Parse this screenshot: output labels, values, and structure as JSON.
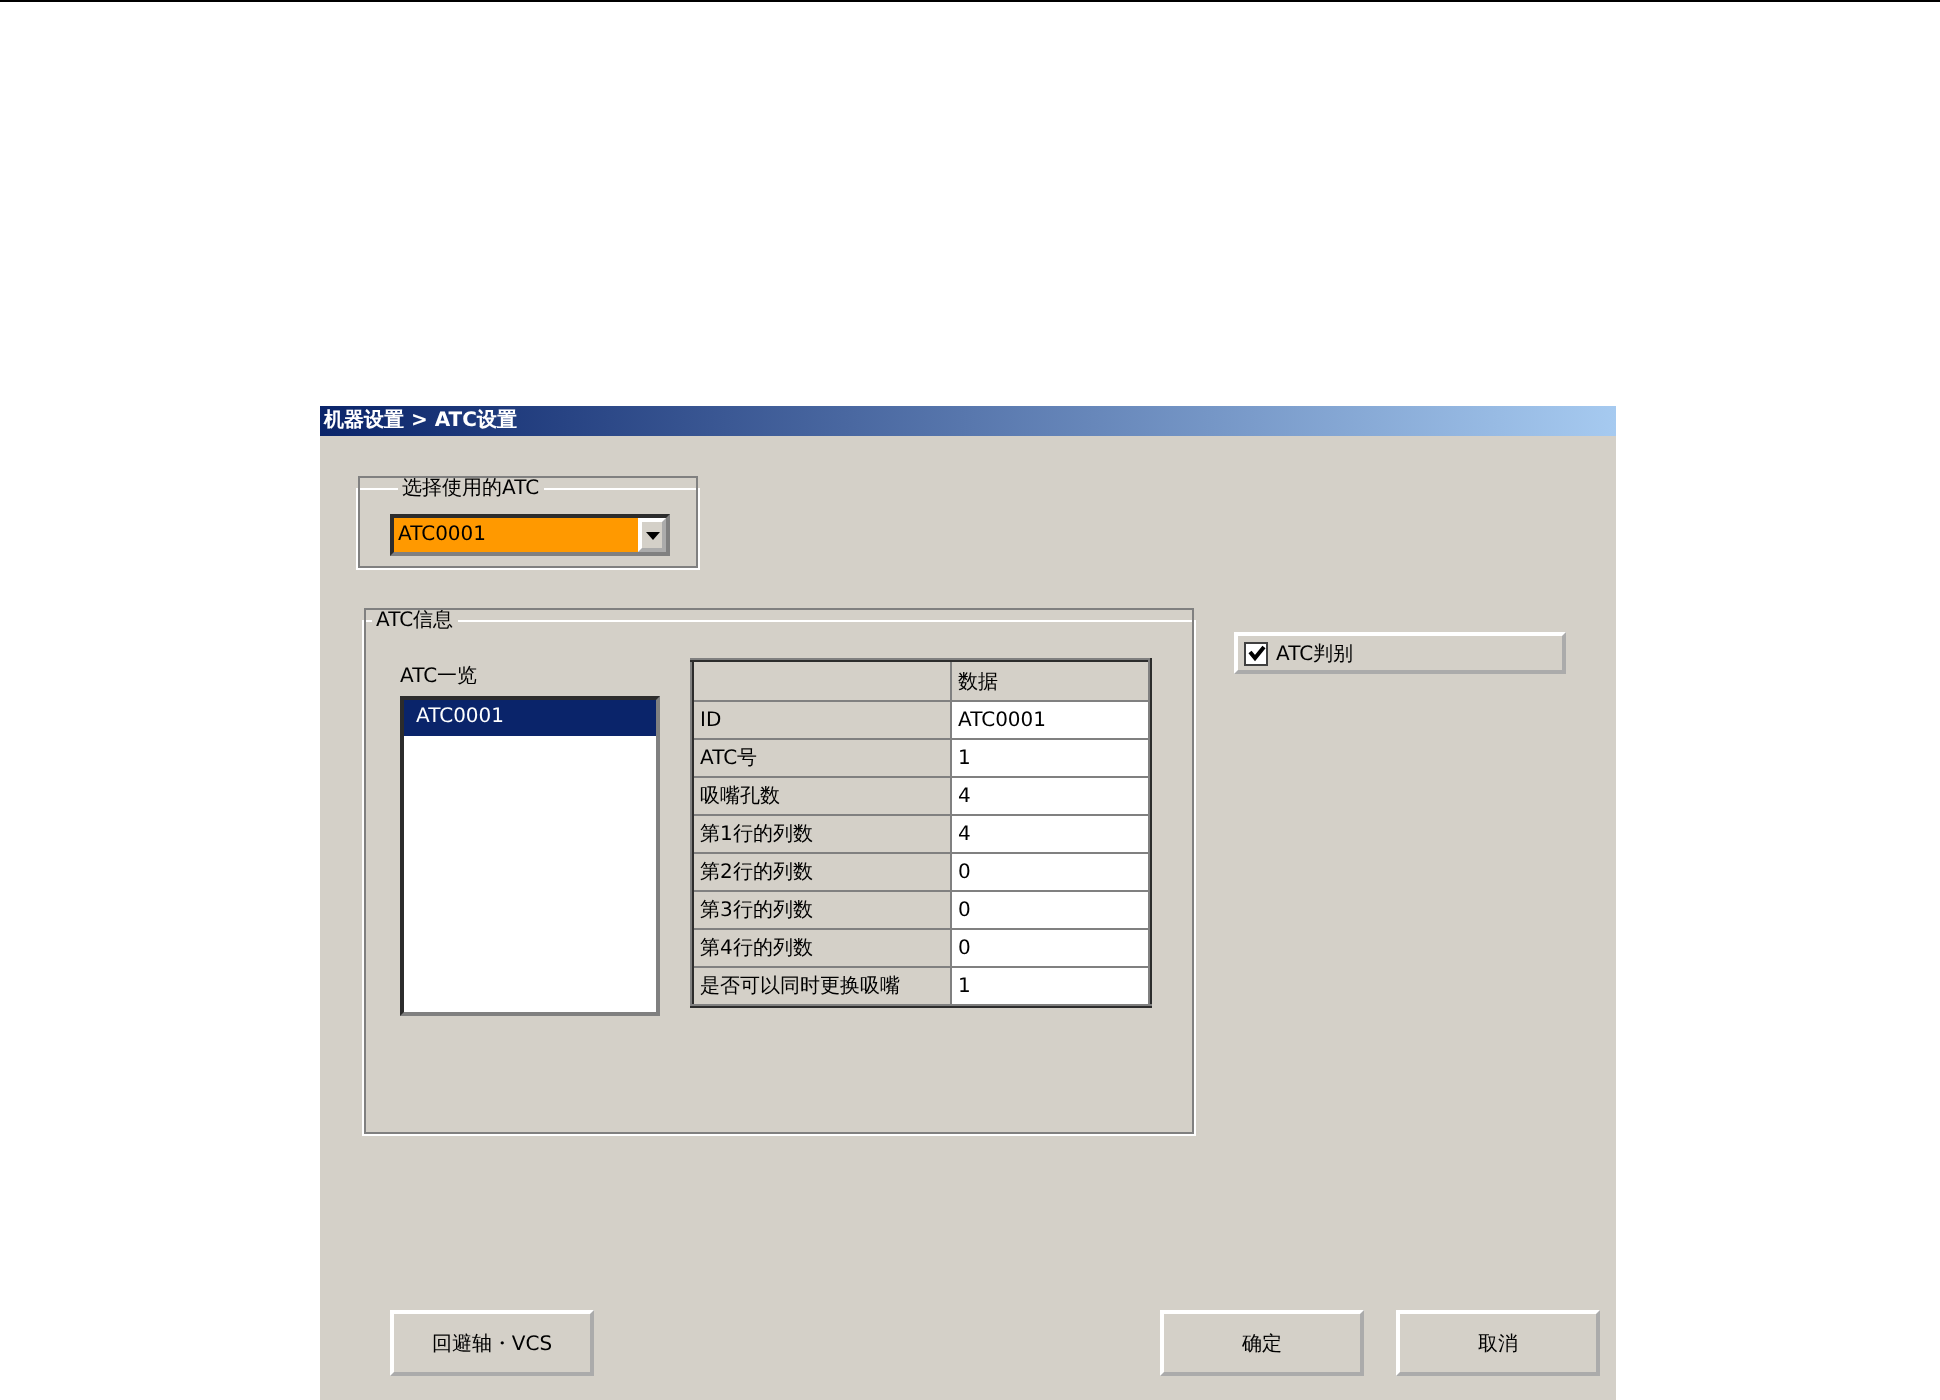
{
  "window": {
    "title": "机器设置 > ATC设置"
  },
  "atc_select": {
    "label": "选择使用的ATC",
    "value": "ATC0001"
  },
  "atc_info": {
    "label": "ATC信息",
    "list_label": "ATC一览",
    "list_items": [
      {
        "label": "ATC0001",
        "selected": true
      }
    ],
    "table": {
      "columns": [
        "",
        "数据"
      ],
      "rows": [
        {
          "name": "ID",
          "value": "ATC0001"
        },
        {
          "name": "ATC号",
          "value": "1"
        },
        {
          "name": "吸嘴孔数",
          "value": "4"
        },
        {
          "name": "第1行的列数",
          "value": "4"
        },
        {
          "name": "第2行的列数",
          "value": "0"
        },
        {
          "name": "第3行的列数",
          "value": "0"
        },
        {
          "name": "第4行的列数",
          "value": "0"
        },
        {
          "name": "是否可以同时更换吸嘴",
          "value": "1"
        }
      ]
    }
  },
  "atc_check": {
    "label": "ATC判别",
    "checked": true
  },
  "buttons": [
    {
      "label": "回避轴・VCS"
    },
    {
      "label": "确定"
    },
    {
      "label": "取消"
    }
  ]
}
